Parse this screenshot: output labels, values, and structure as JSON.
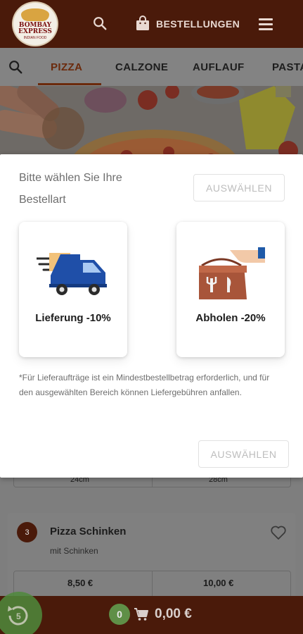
{
  "header": {
    "logo": {
      "line1": "BOMBAY",
      "line2": "EXPRESS",
      "line3": "INDIAN FOOD"
    },
    "orders_label": "BESTELLUNGEN",
    "icons": {
      "search": "search-icon",
      "bag": "shopping-bag-icon",
      "menu": "menu-icon"
    }
  },
  "tabs": [
    {
      "label": "PIZZA",
      "active": true
    },
    {
      "label": "CALZONE",
      "active": false
    },
    {
      "label": "AUFLAUF",
      "active": false
    },
    {
      "label": "PASTA",
      "active": false
    }
  ],
  "modal": {
    "title": "Bitte wählen Sie Ihre Bestellart",
    "select_label": "AUSWÄHLEN",
    "options": {
      "delivery": {
        "label": "Lieferung  -10%",
        "icon": "delivery-truck-icon"
      },
      "pickup": {
        "label": "Abholen  -20%",
        "icon": "takeaway-bag-icon"
      }
    },
    "note": "*Für Lieferaufträge ist ein Mindestbestellbetrag erforderlich, und für den ausgewählten Bereich können Liefergebühren anfallen.",
    "confirm_label": "AUSWÄHLEN"
  },
  "background_item": {
    "sizes_above": [
      "24cm",
      "28cm"
    ],
    "number": "3",
    "title": "Pizza Schinken",
    "description": "mit Schinken",
    "prices": [
      "8,50 €",
      "10,00 €"
    ]
  },
  "cart": {
    "count": "0",
    "total": "0,00 €"
  },
  "colors": {
    "brand": "#4a1a0a",
    "accent_green": "#5f8f47",
    "truck_blue": "#1f4fa8"
  }
}
